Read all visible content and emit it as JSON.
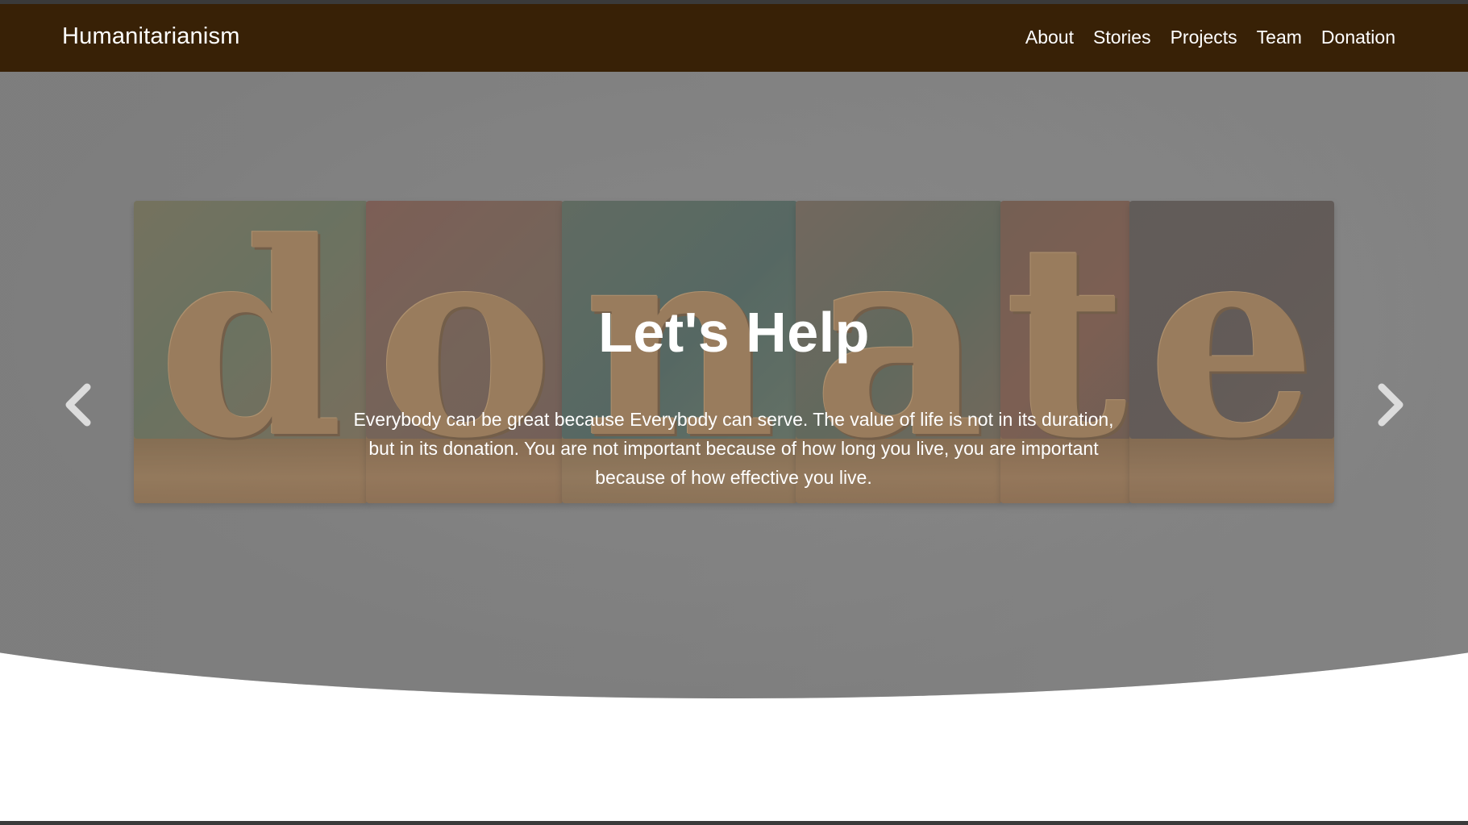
{
  "navbar": {
    "brand": "Humanitarianism",
    "links": [
      "About",
      "Stories",
      "Projects",
      "Team",
      "Donation"
    ]
  },
  "hero": {
    "image_word": "donate",
    "title": "Let's Help",
    "text": "Everybody can be great because Everybody can serve. The value of life is not in its duration, but in its donation. You are not important because of how long you live, you are important because of how effective you live.",
    "prev_icon": "chevron-left-icon",
    "next_icon": "chevron-right-icon"
  },
  "colors": {
    "navbar_bg": "#382106",
    "hero_overlay": "#848484",
    "text": "#ffffff"
  }
}
